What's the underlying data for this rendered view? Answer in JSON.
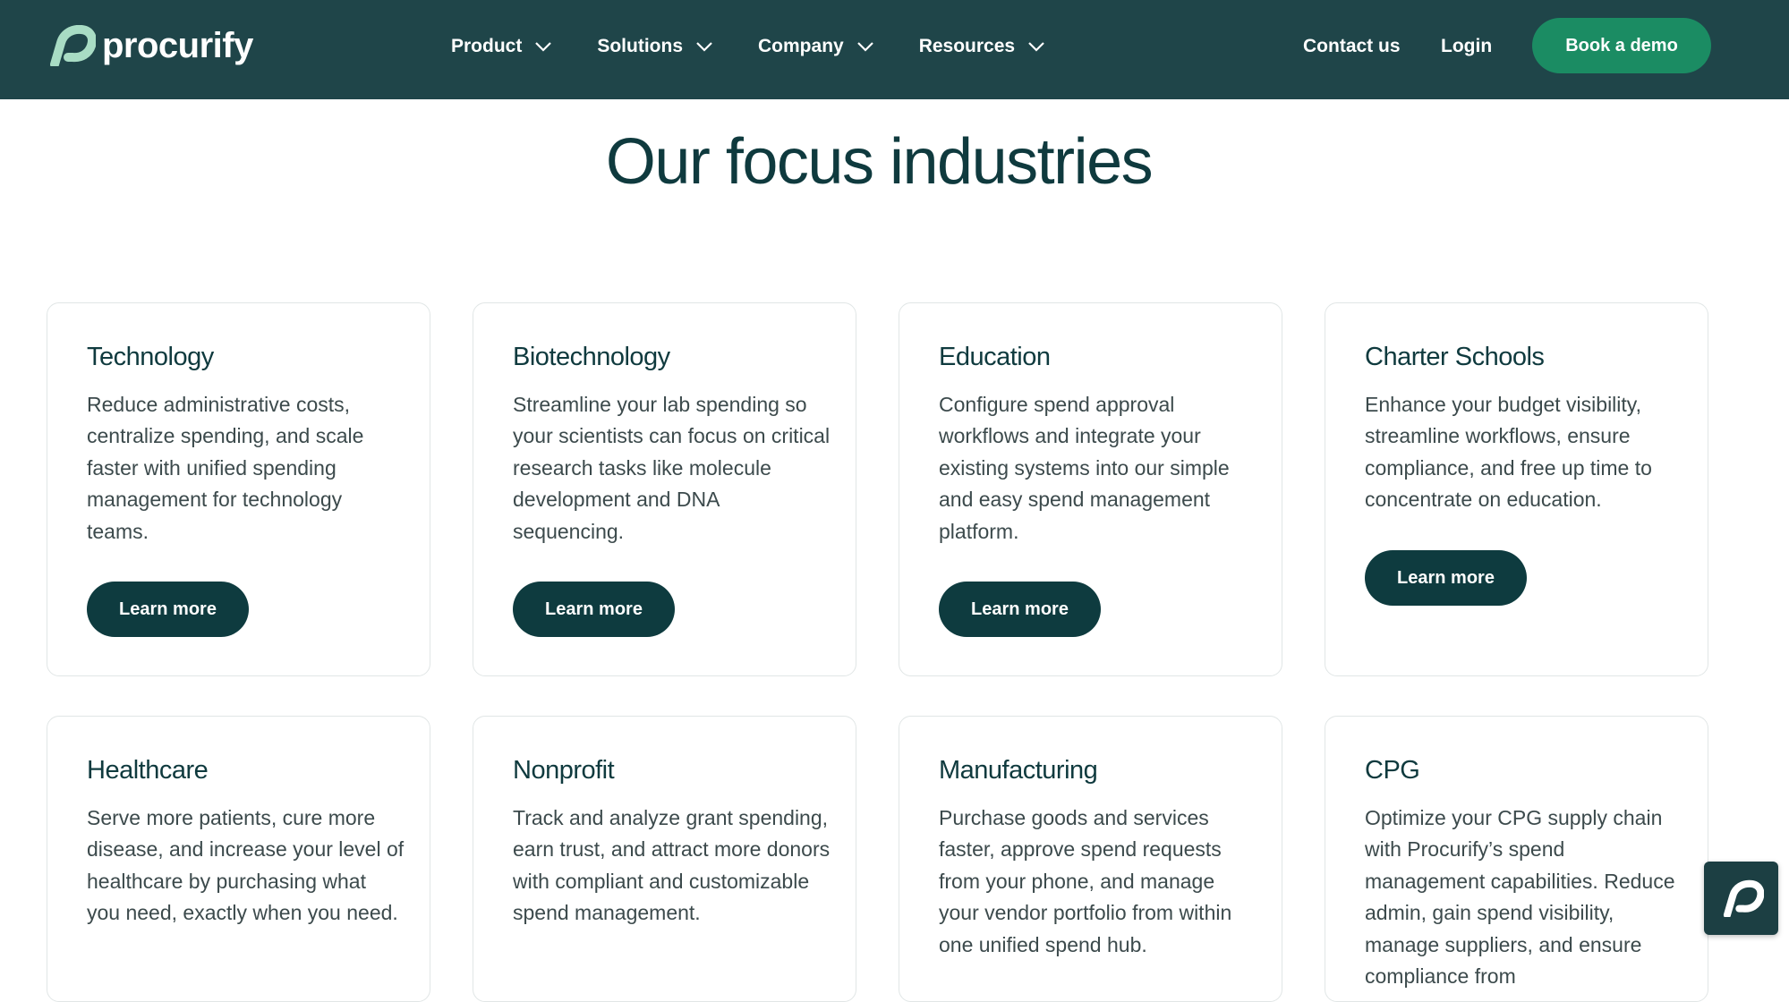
{
  "brand": {
    "name": "procurify",
    "logo_icon": "procurify-logo-icon"
  },
  "nav": {
    "menu": [
      {
        "label": "Product",
        "icon": "chevron-down-icon"
      },
      {
        "label": "Solutions",
        "icon": "chevron-down-icon"
      },
      {
        "label": "Company",
        "icon": "chevron-down-icon"
      },
      {
        "label": "Resources",
        "icon": "chevron-down-icon"
      }
    ],
    "contact_label": "Contact us",
    "login_label": "Login",
    "cta_label": "Book a demo"
  },
  "section": {
    "title": "Our focus industries"
  },
  "industries": [
    {
      "title": "Technology",
      "description": "Reduce administrative costs, centralize spending, and scale faster with unified spending management for technology teams.",
      "button": "Learn more"
    },
    {
      "title": "Biotechnology",
      "description": "Streamline your lab spending so your scientists can focus on critical research tasks like molecule development and DNA sequencing.",
      "button": "Learn more"
    },
    {
      "title": "Education",
      "description": "Configure spend approval workflows and integrate your existing systems into our simple and easy spend management platform.",
      "button": "Learn more"
    },
    {
      "title": "Charter Schools",
      "description": "Enhance your budget visibility, streamline workflows, ensure compliance, and free up time to concentrate on education.",
      "button": "Learn more"
    },
    {
      "title": "Healthcare",
      "description": "Serve more patients, cure more disease, and increase your level of healthcare by purchasing what you need, exactly when you need."
    },
    {
      "title": "Nonprofit",
      "description": "Track and analyze grant spending, earn trust, and attract more donors with compliant and customizable spend management."
    },
    {
      "title": "Manufacturing",
      "description": "Purchase goods and services faster, approve spend requests from your phone, and manage your vendor portfolio from within one unified spend hub."
    },
    {
      "title": "CPG",
      "description": "Optimize your CPG supply chain with Procurify’s spend management capabilities. Reduce admin, gain spend visibility, manage suppliers, and ensure compliance from"
    }
  ],
  "colors": {
    "nav_bg": "#1f4549",
    "cta_green": "#1b8c63",
    "button_dark": "#0e3b3f",
    "heading": "#0f3a3e"
  },
  "widget": {
    "icon": "procurify-chat-icon"
  }
}
